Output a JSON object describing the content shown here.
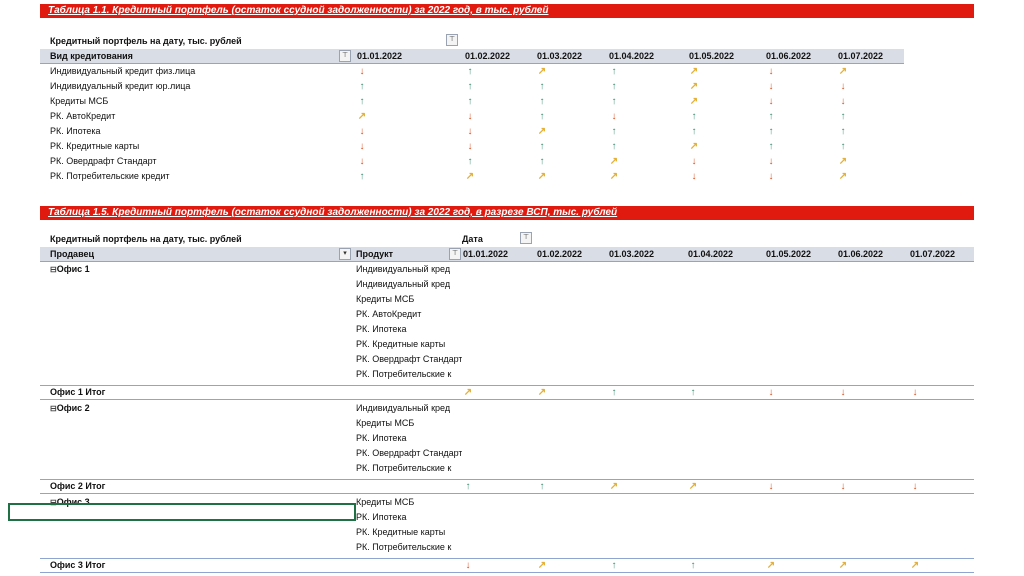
{
  "table1": {
    "title": "Таблица 1.1.  Кредитный портфель (остаток ссудной задолженности) за 2022 год, в тыс. рублей",
    "filter_label": "Кредитный портфель на дату, тыс. рублей",
    "row_header": "Вид кредитования",
    "dates": [
      "01.01.2022",
      "01.02.2022",
      "01.03.2022",
      "01.04.2022",
      "01.05.2022",
      "01.06.2022",
      "01.07.2022"
    ],
    "rows": [
      {
        "label": "Индивидуальный кредит физ.лица",
        "trends": [
          "down",
          "up",
          "side",
          "up",
          "side",
          "down",
          "side"
        ]
      },
      {
        "label": "Индивидуальный кредит юр.лица",
        "trends": [
          "up",
          "up",
          "up",
          "up",
          "side",
          "down",
          "down"
        ]
      },
      {
        "label": "Кредиты МСБ",
        "trends": [
          "up",
          "up",
          "up",
          "up",
          "side",
          "down",
          "down"
        ]
      },
      {
        "label": "РК. АвтоКредит",
        "trends": [
          "side",
          "down",
          "up",
          "down",
          "up",
          "up",
          "up"
        ]
      },
      {
        "label": "РК. Ипотека",
        "trends": [
          "down",
          "down",
          "side",
          "up",
          "up",
          "up",
          "up"
        ]
      },
      {
        "label": "РК. Кредитные карты",
        "trends": [
          "down",
          "down",
          "up",
          "up",
          "side",
          "up",
          "up"
        ]
      },
      {
        "label": "РК. Овердрафт Стандарт",
        "trends": [
          "down",
          "up",
          "up",
          "side",
          "down",
          "down",
          "side"
        ]
      },
      {
        "label": "РК. Потребительские кредит",
        "trends": [
          "up",
          "side",
          "side",
          "side",
          "down",
          "down",
          "side"
        ]
      }
    ]
  },
  "table2": {
    "title": "Таблица 1.5. Кредитный портфель (остаток ссудной задолженности) за 2022 год, в разрезе ВСП, тыс. рублей",
    "filter_label": "Кредитный портфель на дату, тыс. рублей",
    "date_label": "Дата",
    "seller_header": "Продавец",
    "product_header": "Продукт",
    "dates": [
      "01.01.2022",
      "01.02.2022",
      "01.03.2022",
      "01.04.2022",
      "01.05.2022",
      "01.06.2022",
      "01.07.2022"
    ],
    "offices": [
      {
        "name": "Офис 1",
        "products": [
          "Индивидуальный кред",
          "Индивидуальный кред",
          "Кредиты МСБ",
          "РК. АвтоКредит",
          "РК. Ипотека",
          "РК. Кредитные карты",
          "РК. Овердрафт Стандарт",
          "РК. Потребительские к"
        ],
        "total_label": "Офис 1 Итог",
        "totals": [
          "side",
          "side",
          "up",
          "up",
          "down",
          "down",
          "down"
        ]
      },
      {
        "name": "Офис 2",
        "products": [
          "Индивидуальный кред",
          "Кредиты МСБ",
          "РК. Ипотека",
          "РК. Овердрафт Стандарт",
          "РК. Потребительские к"
        ],
        "total_label": "Офис 2 Итог",
        "totals": [
          "up",
          "up",
          "side",
          "side",
          "down",
          "down",
          "down"
        ]
      },
      {
        "name": "Офис 3",
        "products": [
          "Кредиты МСБ",
          "РК. Ипотека",
          "РК. Кредитные карты",
          "РК. Потребительские к"
        ],
        "total_label": "Офис 3 Итог",
        "totals": [
          "down",
          "side",
          "up",
          "up",
          "side",
          "side",
          "side"
        ]
      }
    ]
  },
  "icons": {
    "up": "↑",
    "down": "↓",
    "side": "↗",
    "filter": "⊤",
    "expand": "⊟"
  },
  "colors": {
    "title_bar": "#e01a0f",
    "up": "#3f8f77",
    "down": "#d94e1f",
    "side": "#e3b03a",
    "header_band": "#d9dde6"
  }
}
